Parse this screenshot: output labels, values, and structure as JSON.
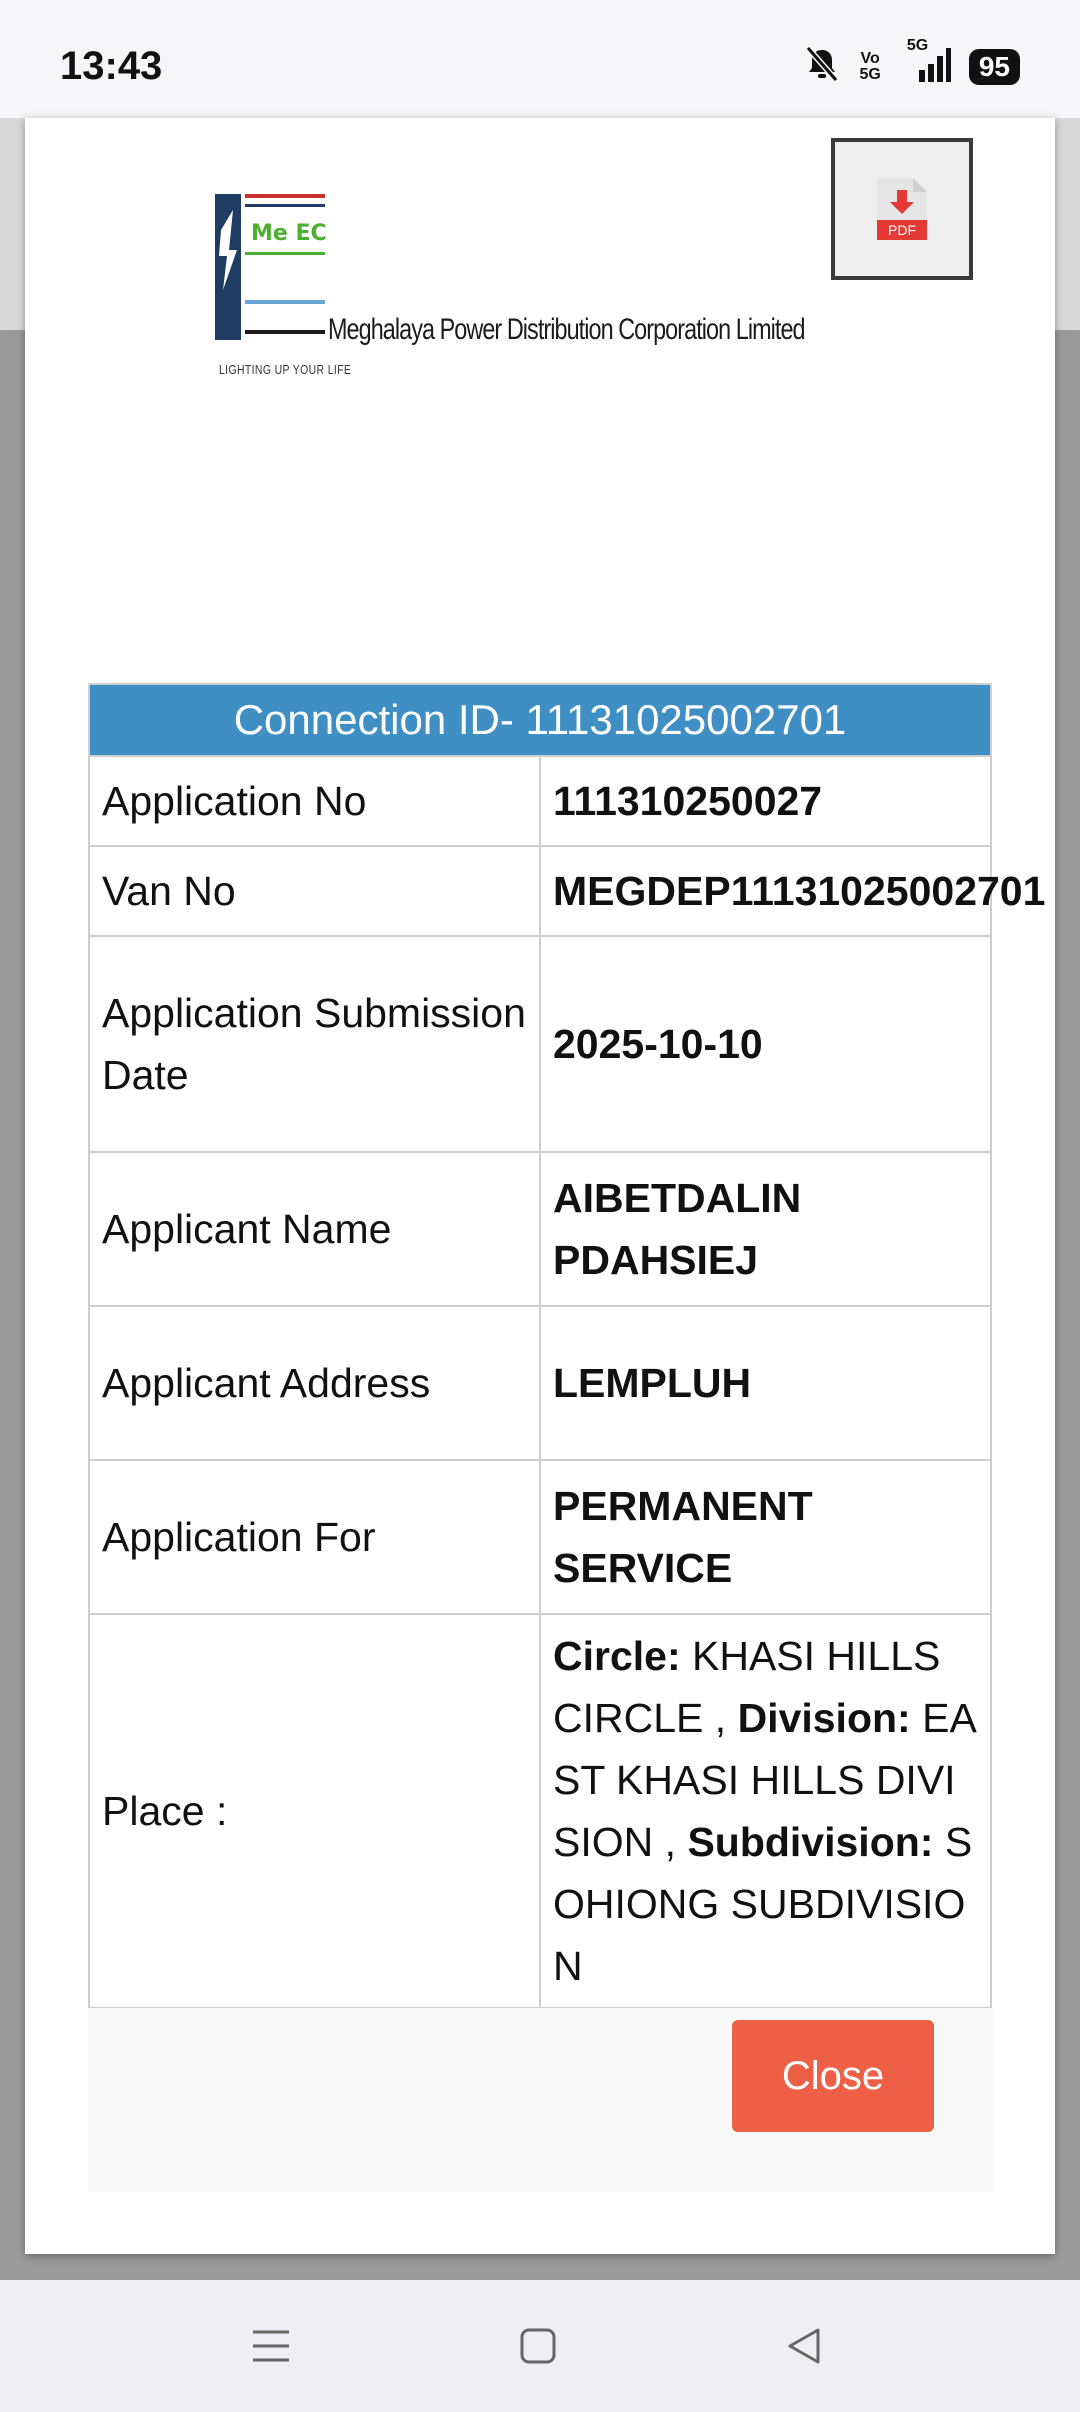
{
  "status_bar": {
    "time": "13:43",
    "net_top": "Vo",
    "net_bottom": "5G",
    "net_signal": "5G",
    "battery": "95"
  },
  "header": {
    "company_name": "Meghalaya Power Distribution Corporation  Limited",
    "logo_abbrev": "Me ECL",
    "tagline": "LIGHTING UP YOUR LIFE",
    "pdf_label": "PDF"
  },
  "details": {
    "title": "Connection ID- 11131025002701",
    "rows": [
      {
        "label": "Application No",
        "value": "111310250027"
      },
      {
        "label": "Van No",
        "value": "MEGDEP11131025002701"
      },
      {
        "label": "Application Submission Date",
        "value": "2025-10-10"
      },
      {
        "label": "Applicant Name",
        "value": "AIBETDALIN PDAHSIEJ"
      },
      {
        "label": "Applicant Address",
        "value": "LEMPLUH"
      },
      {
        "label": "Application For",
        "value": "PERMANENT SERVICE"
      }
    ],
    "place": {
      "label": "Place :",
      "circle_label": "Circle:",
      "circle_value": " KHASI HILLS CIRCLE ",
      "sep1": ", ",
      "division_label": "Division:",
      "division_value": " EAST KHASI HILLS DIVISION ",
      "sep2": ", ",
      "subdivision_label": "Subdivision:",
      "subdivision_value": " SOHIONG SUBDIVISION"
    }
  },
  "footer": {
    "close_label": "Close"
  },
  "colors": {
    "header_bg": "#3f8fc4",
    "close_bg": "#ee6046"
  }
}
